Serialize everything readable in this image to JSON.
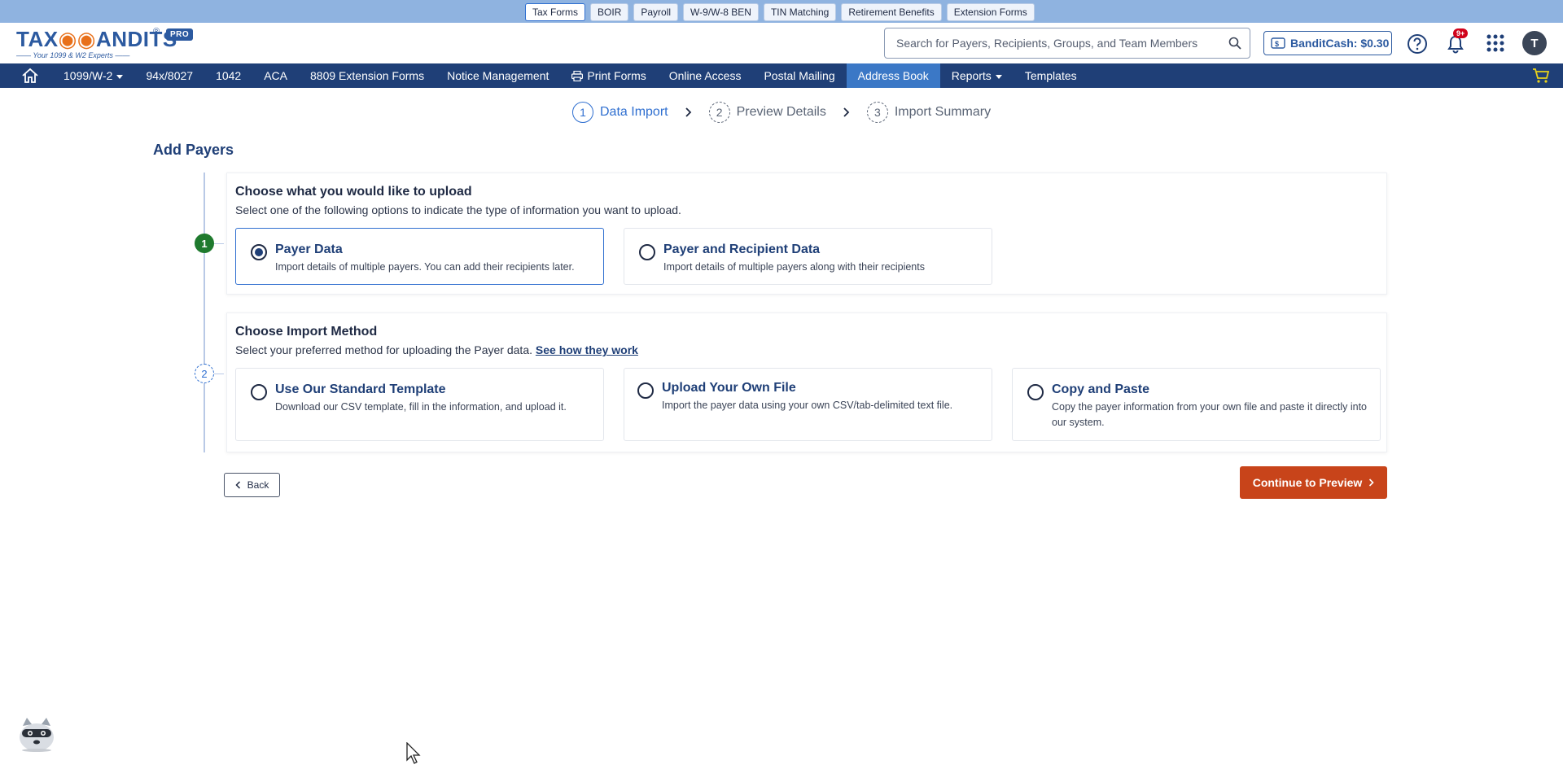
{
  "product_tabs": [
    "Tax Forms",
    "BOIR",
    "Payroll",
    "W-9/W-8 BEN",
    "TIN Matching",
    "Retirement Benefits",
    "Extension Forms"
  ],
  "logo": {
    "text_left": "TAX",
    "text_right": "ANDITS",
    "registered": "®",
    "pro": "PRO",
    "tagline": "—— Your 1099 & W2 Experts ——"
  },
  "search": {
    "placeholder": "Search for Payers, Recipients, Groups, and Team Members",
    "value": ""
  },
  "banditcash": {
    "label": "BanditCash: $0.30"
  },
  "notifications": {
    "badge": "9+"
  },
  "user": {
    "initial": "T"
  },
  "nav": {
    "items": [
      "1099/W-2",
      "94x/8027",
      "1042",
      "ACA",
      "8809 Extension Forms",
      "Notice Management",
      "Print Forms",
      "Online Access",
      "Postal Mailing",
      "Address Book",
      "Reports",
      "Templates"
    ],
    "active": "Address Book"
  },
  "stepper": {
    "steps": [
      {
        "num": "1",
        "label": "Data Import"
      },
      {
        "num": "2",
        "label": "Preview Details"
      },
      {
        "num": "3",
        "label": "Import Summary"
      }
    ]
  },
  "page": {
    "title": "Add Payers"
  },
  "section1": {
    "num": "1",
    "title": "Choose what you would like to upload",
    "desc": "Select one of the following options to indicate the type of information you want to upload.",
    "options": [
      {
        "title": "Payer Data",
        "desc": "Import details of multiple payers. You can add their recipients later.",
        "checked": true
      },
      {
        "title": "Payer and Recipient Data",
        "desc": "Import details of multiple payers along with their recipients",
        "checked": false
      }
    ]
  },
  "section2": {
    "num": "2",
    "title": "Choose Import Method",
    "desc": "Select your preferred method for uploading the Payer data.",
    "link": "See how they work",
    "options": [
      {
        "title": "Use Our Standard Template",
        "desc": "Download our CSV template, fill in the information, and upload it.",
        "checked": false
      },
      {
        "title": "Upload Your Own File",
        "desc": "Import the payer data using your own CSV/tab-delimited text file.",
        "checked": false
      },
      {
        "title": "Copy and Paste",
        "desc": "Copy the payer information from your own file and paste it directly into our system.",
        "checked": false
      }
    ]
  },
  "buttons": {
    "back": "Back",
    "continue": "Continue to Preview"
  },
  "colors": {
    "brand": "#1f3f77",
    "accent": "#2f6fd0",
    "cta": "#c8441a",
    "success": "#1f7a2e"
  }
}
